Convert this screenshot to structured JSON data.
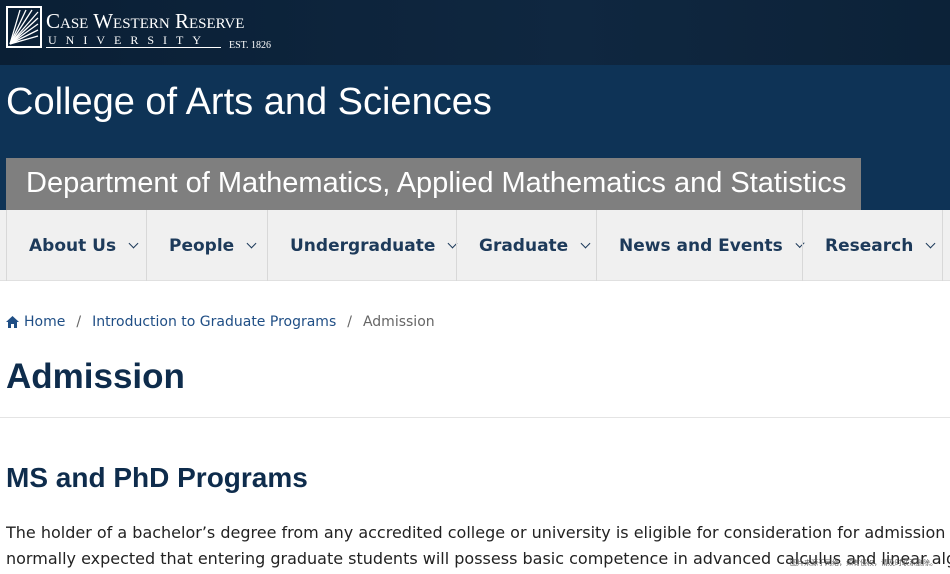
{
  "university": {
    "name": "Case Western Reserve",
    "sub": "UNIVERSITY",
    "est": "EST. 1826"
  },
  "college": {
    "title": "College of Arts and Sciences"
  },
  "department": {
    "title": "Department of Mathematics, Applied Mathematics and Statistics"
  },
  "nav": {
    "items": [
      {
        "label": "About Us"
      },
      {
        "label": "People"
      },
      {
        "label": "Undergraduate"
      },
      {
        "label": "Graduate"
      },
      {
        "label": "News and Events"
      },
      {
        "label": "Research"
      }
    ]
  },
  "breadcrumb": {
    "home": "Home",
    "parent": "Introduction to Graduate Programs",
    "separator": "/",
    "current": "Admission"
  },
  "page": {
    "title": "Admission",
    "section_title": "MS and PhD Programs",
    "paragraph_line1": "The holder of a bachelor’s degree from any accredited college or university is eligible for consideration for admission to our graduate program. It is",
    "paragraph_line2": "normally expected that entering graduate students will possess basic competence in advanced calculus and linear algebra.",
    "watermark": "图片来源于网络，如有侵权，请及时联系删除。"
  },
  "colors": {
    "topbar": "#0c2238",
    "college_bg": "#0e3356",
    "dept_bg": "#7f7f7f",
    "nav_bg": "#f0f0f0",
    "nav_text": "#1d3a5a",
    "link": "#1f4e85",
    "heading": "#0e2c4c"
  }
}
